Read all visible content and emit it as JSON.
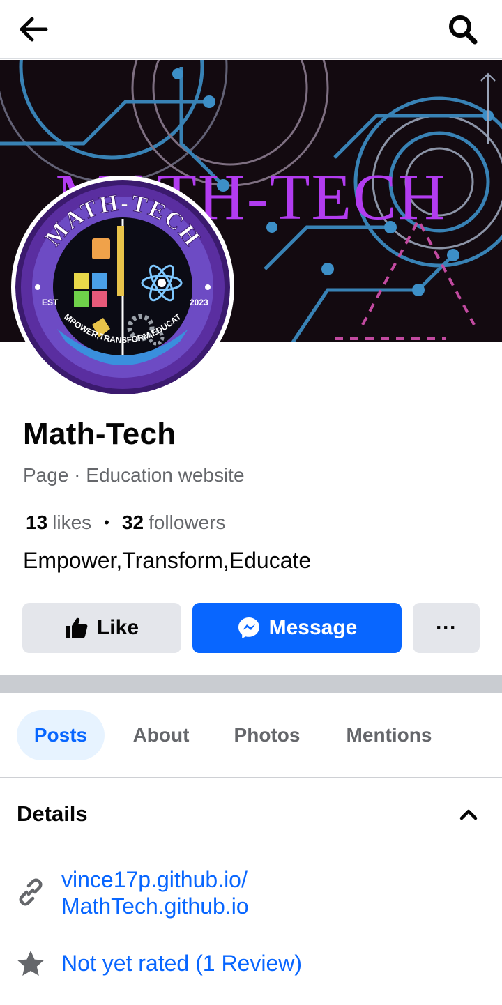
{
  "header": {
    "back_icon": "arrow-left-icon",
    "search_icon": "search-icon"
  },
  "cover": {
    "title": "MATH-TECH",
    "accent_color": "#b23cf0",
    "line_color": "#3d8fc7"
  },
  "avatar": {
    "ring_text": "MATH-TECH",
    "left_text": "EST",
    "right_text": "2023",
    "banner_text": "EMPOWER,TRANSFORM,EDUCATE"
  },
  "profile": {
    "name": "Math-Tech",
    "category": "Page · Education website",
    "likes_count": "13",
    "likes_label": "likes",
    "separator": "•",
    "followers_count": "32",
    "followers_label": "followers",
    "tagline": "Empower,Transform,Educate"
  },
  "actions": {
    "like_label": "Like",
    "message_label": "Message",
    "more_label": "···",
    "brand_color": "#0866ff"
  },
  "tabs": [
    {
      "label": "Posts",
      "active": true
    },
    {
      "label": "About",
      "active": false
    },
    {
      "label": "Photos",
      "active": false
    },
    {
      "label": "Mentions",
      "active": false
    }
  ],
  "details": {
    "title": "Details",
    "link_line1": "vince17p.github.io/",
    "link_line2": "MathTech.github.io",
    "rating": "Not yet rated (1 Review)"
  }
}
